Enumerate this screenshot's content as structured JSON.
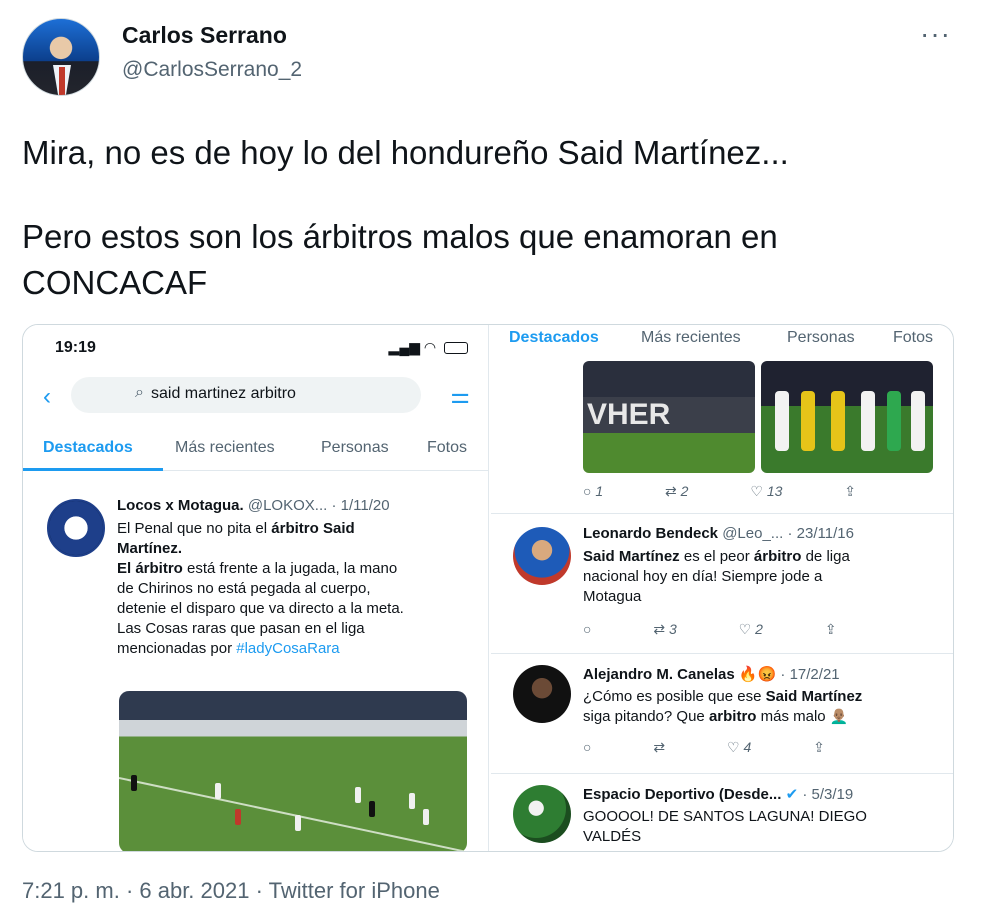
{
  "author": {
    "name": "Carlos Serrano",
    "handle": "@CarlosSerrano_2",
    "more_icon": "···"
  },
  "tweet": {
    "paragraph1": "Mira, no es de hoy lo del hondureño Said Martínez...",
    "paragraph2": "Pero estos son los árbitros malos que enamoran en CONCACAF"
  },
  "footer": {
    "meta": "7:21 p. m. · 6 abr. 2021 · Twitter for iPhone"
  },
  "left_screenshot": {
    "status_time": "19:19",
    "search_query": "said martinez arbitro",
    "tabs": [
      "Destacados",
      "Más recientes",
      "Personas",
      "Fotos"
    ],
    "post": {
      "name": "Locos x Motagua.",
      "handle": "@LOKOX...",
      "date": "· 1/11/20",
      "line1": "El Penal que no pita el",
      "line1_bold": "árbitro Said",
      "line2_bold": "Martínez.",
      "line3_bold": "El árbitro",
      "line3": "está frente a la jugada, la mano",
      "line4": "de Chirinos no está pegada al cuerpo,",
      "line5": "detenie el disparo que va directo a la meta.",
      "line6": "Las Cosas raras que pasan en el liga",
      "line7": "mencionadas por",
      "hashtag": "#ladyCosaRara"
    }
  },
  "right_screenshot": {
    "tabs": [
      "Destacados",
      "Más recientes",
      "Personas",
      "Fotos"
    ],
    "image_text": "VHER",
    "top_actions": {
      "replies": "1",
      "retweets": "2",
      "likes": "13"
    },
    "posts": [
      {
        "name": "Leonardo Bendeck",
        "handle": "@Leo_...",
        "date": "· 23/11/16",
        "bold": "Said Martínez",
        "text1": "es el peor",
        "bold2": "árbitro",
        "text2": "de liga",
        "text3": "nacional hoy en día! Siempre jode a",
        "text4": "Motagua",
        "replies": "",
        "retweets": "3",
        "likes": "2"
      },
      {
        "name": "Alejandro M. Canelas",
        "emoji": "🔥😡",
        "date": "· 17/2/21",
        "text1": "¿Cómo es posible que ese",
        "bold": "Said Martínez",
        "text2": "siga pitando? Que",
        "bold2": "arbitro",
        "text3": "más malo",
        "replies": "",
        "retweets": "",
        "likes": "4"
      },
      {
        "name": "Espacio Deportivo (Desde...",
        "date": "· 5/3/19",
        "text1": "GOOOOL! DE SANTOS LAGUNA! DIEGO",
        "text2": "VALDÉS"
      }
    ]
  },
  "icons": {
    "reply": "reply-icon",
    "retweet": "retweet-icon",
    "like": "heart-icon",
    "share": "share-icon"
  },
  "colors": {
    "accent": "#1d9bf0",
    "muted": "#536471",
    "text": "#0f1419"
  }
}
